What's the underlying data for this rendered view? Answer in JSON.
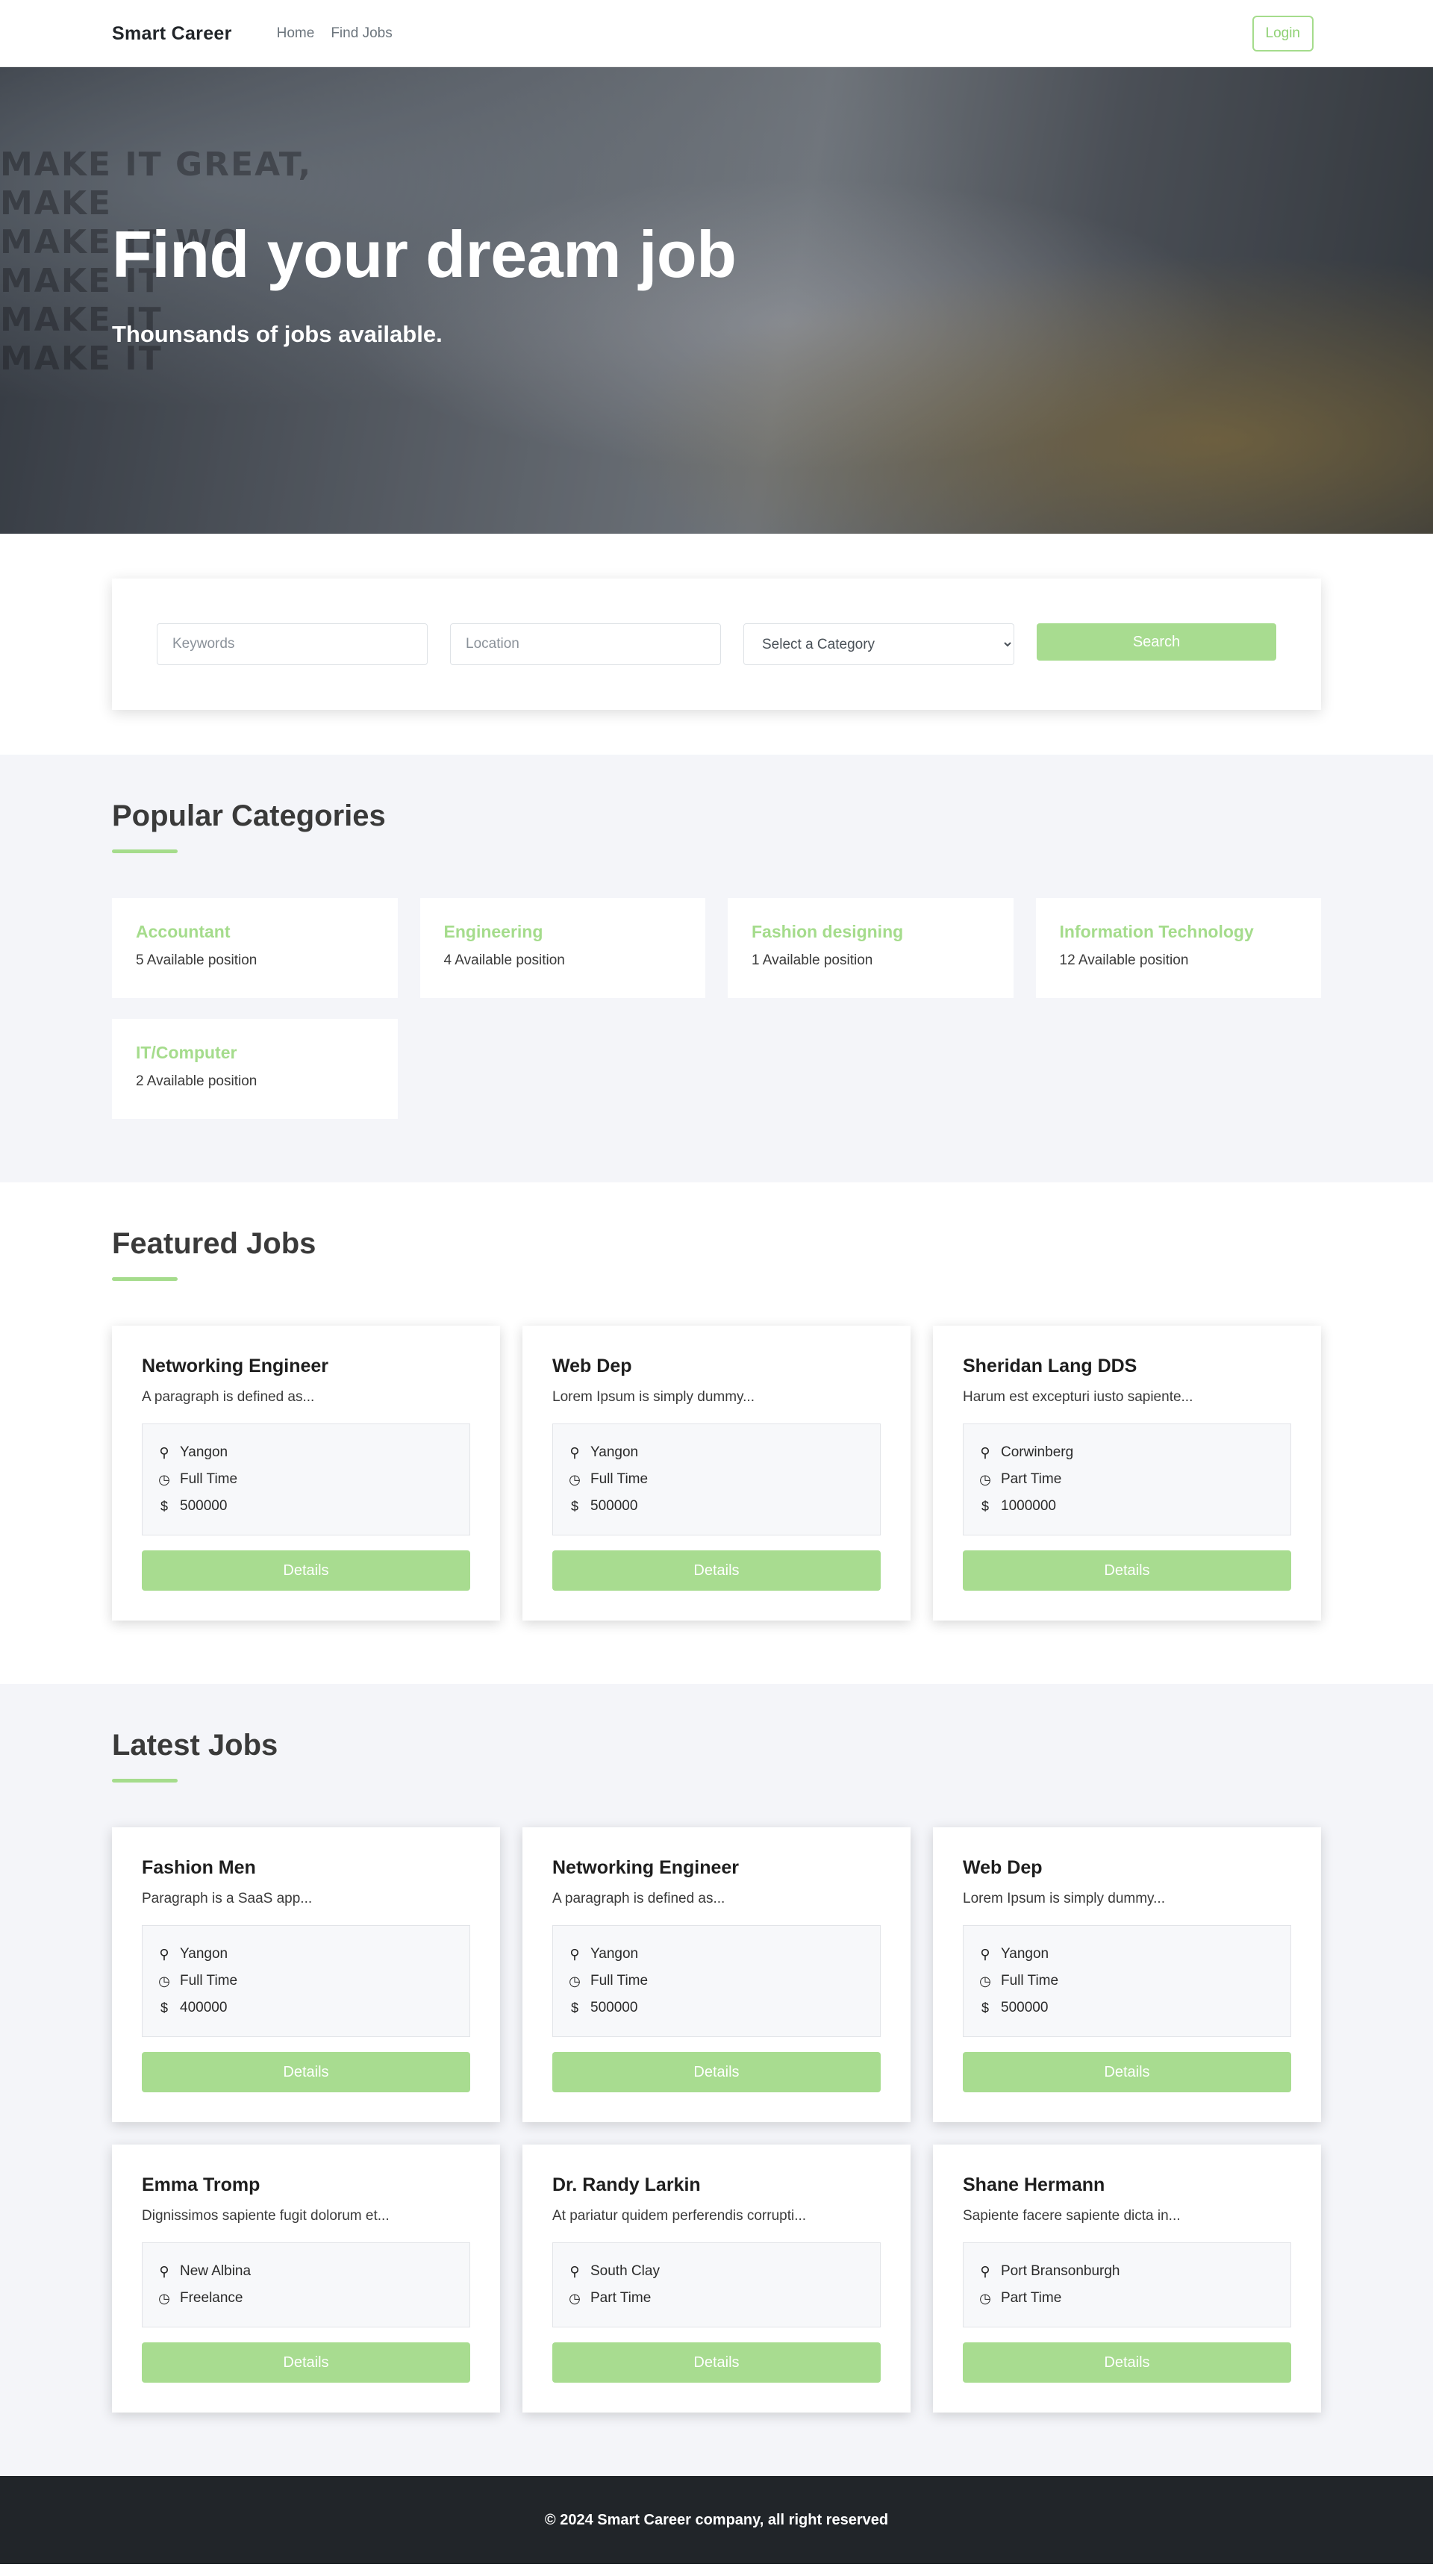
{
  "nav": {
    "brand": "Smart Career",
    "links": [
      "Home",
      "Find Jobs"
    ],
    "login_label": "Login"
  },
  "hero": {
    "title": "Find your dream job",
    "subtitle": "Thounsands of jobs available.",
    "background_text": [
      "MAKE IT GREAT, MAKE",
      "MAKE IT WO",
      "MAKE IT",
      "MAKE IT",
      "MAKE IT"
    ]
  },
  "search": {
    "keywords_placeholder": "Keywords",
    "location_placeholder": "Location",
    "category_selected": "Select a Category",
    "button_label": "Search"
  },
  "categories": {
    "title": "Popular Categories",
    "items": [
      {
        "name": "Accountant",
        "count": "5 Available position"
      },
      {
        "name": "Engineering",
        "count": "4 Available position"
      },
      {
        "name": "Fashion designing",
        "count": "1 Available position"
      },
      {
        "name": "Information Technology",
        "count": "12 Available position"
      },
      {
        "name": "IT/Computer",
        "count": "2 Available position"
      }
    ]
  },
  "featured": {
    "title": "Featured Jobs",
    "jobs": [
      {
        "title": "Networking Engineer",
        "desc": "A paragraph is defined as...",
        "location": "Yangon",
        "type": "Full Time",
        "salary": "500000",
        "button": "Details"
      },
      {
        "title": "Web Dep",
        "desc": "Lorem Ipsum is simply dummy...",
        "location": "Yangon",
        "type": "Full Time",
        "salary": "500000",
        "button": "Details"
      },
      {
        "title": "Sheridan Lang DDS",
        "desc": "Harum est excepturi iusto sapiente...",
        "location": "Corwinberg",
        "type": "Part Time",
        "salary": "1000000",
        "button": "Details"
      }
    ]
  },
  "latest": {
    "title": "Latest Jobs",
    "jobs": [
      {
        "title": "Fashion Men",
        "desc": "Paragraph is a SaaS app...",
        "location": "Yangon",
        "type": "Full Time",
        "salary": "400000",
        "button": "Details"
      },
      {
        "title": "Networking Engineer",
        "desc": "A paragraph is defined as...",
        "location": "Yangon",
        "type": "Full Time",
        "salary": "500000",
        "button": "Details"
      },
      {
        "title": "Web Dep",
        "desc": "Lorem Ipsum is simply dummy...",
        "location": "Yangon",
        "type": "Full Time",
        "salary": "500000",
        "button": "Details"
      },
      {
        "title": "Emma Tromp",
        "desc": "Dignissimos sapiente fugit dolorum et...",
        "location": "New Albina",
        "type": "Freelance",
        "button": "Details"
      },
      {
        "title": "Dr. Randy Larkin",
        "desc": "At pariatur quidem perferendis corrupti...",
        "location": "South Clay",
        "type": "Part Time",
        "button": "Details"
      },
      {
        "title": "Shane Hermann",
        "desc": "Sapiente facere sapiente dicta in...",
        "location": "Port Bransonburgh",
        "type": "Part Time",
        "button": "Details"
      }
    ]
  },
  "footer": {
    "text": "© 2024 Smart Career company, all right reserved"
  },
  "icons": {
    "location": "map-marker-icon",
    "type": "clock-icon",
    "salary": "dollar-icon"
  },
  "colors": {
    "accent": "#a5dc8c",
    "footer_bg": "#212529",
    "section_gray": "#f4f5f9"
  }
}
